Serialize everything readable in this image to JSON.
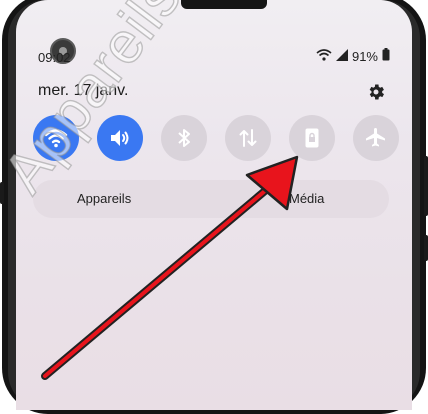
{
  "status_bar": {
    "time": "09:02",
    "battery": "91%"
  },
  "quick_panel": {
    "date": "mer. 17 janv.",
    "tiles": [
      {
        "name": "wifi",
        "state": "on"
      },
      {
        "name": "sound",
        "state": "on"
      },
      {
        "name": "bluetooth",
        "state": "off"
      },
      {
        "name": "mobile-data",
        "state": "off"
      },
      {
        "name": "screen-lock",
        "state": "off"
      },
      {
        "name": "airplane-mode",
        "state": "off"
      }
    ],
    "pill": {
      "left_label": "Appareils",
      "right_label": "Média"
    }
  },
  "watermark": "Appareilsmobiles",
  "colors": {
    "accent_on": "#3a78f2",
    "tile_off": "#d9d3da",
    "arrow": "#e8141c"
  }
}
